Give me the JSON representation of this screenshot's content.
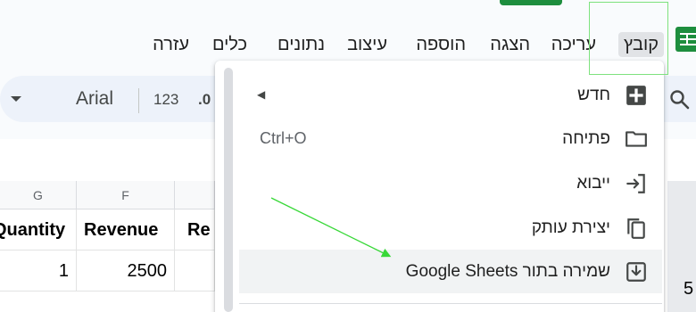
{
  "menubar": {
    "items": [
      {
        "label": "קובץ",
        "active": true
      },
      {
        "label": "עריכה"
      },
      {
        "label": "הצגה"
      },
      {
        "label": "הוספה"
      },
      {
        "label": "עיצוב"
      },
      {
        "label": "נתונים"
      },
      {
        "label": "כלים"
      },
      {
        "label": "עזרה"
      }
    ]
  },
  "toolbar": {
    "font_name": "Arial",
    "format_123": "123",
    "decimal_label": ".0"
  },
  "grid": {
    "columns": [
      "G",
      "F"
    ],
    "headers": [
      "Quantity",
      "Revenue",
      "Re"
    ],
    "row1": [
      "1",
      "2500"
    ],
    "edge_digit": "5"
  },
  "file_menu": {
    "items": [
      {
        "label": "חדש",
        "icon": "new-spreadsheet-icon",
        "submenu": true
      },
      {
        "label": "פתיחה",
        "icon": "folder-icon",
        "shortcut": "Ctrl+O"
      },
      {
        "label": "ייבוא",
        "icon": "import-icon"
      },
      {
        "label": "יצירת עותק",
        "icon": "copy-icon"
      },
      {
        "label": "שמירה בתור Google Sheets",
        "icon": "save-as-icon",
        "highlighted": true
      }
    ]
  },
  "colors": {
    "accent_green": "#1e8e3e",
    "annotation_green": "#38d838",
    "hover_bg": "#f1f3f4"
  }
}
